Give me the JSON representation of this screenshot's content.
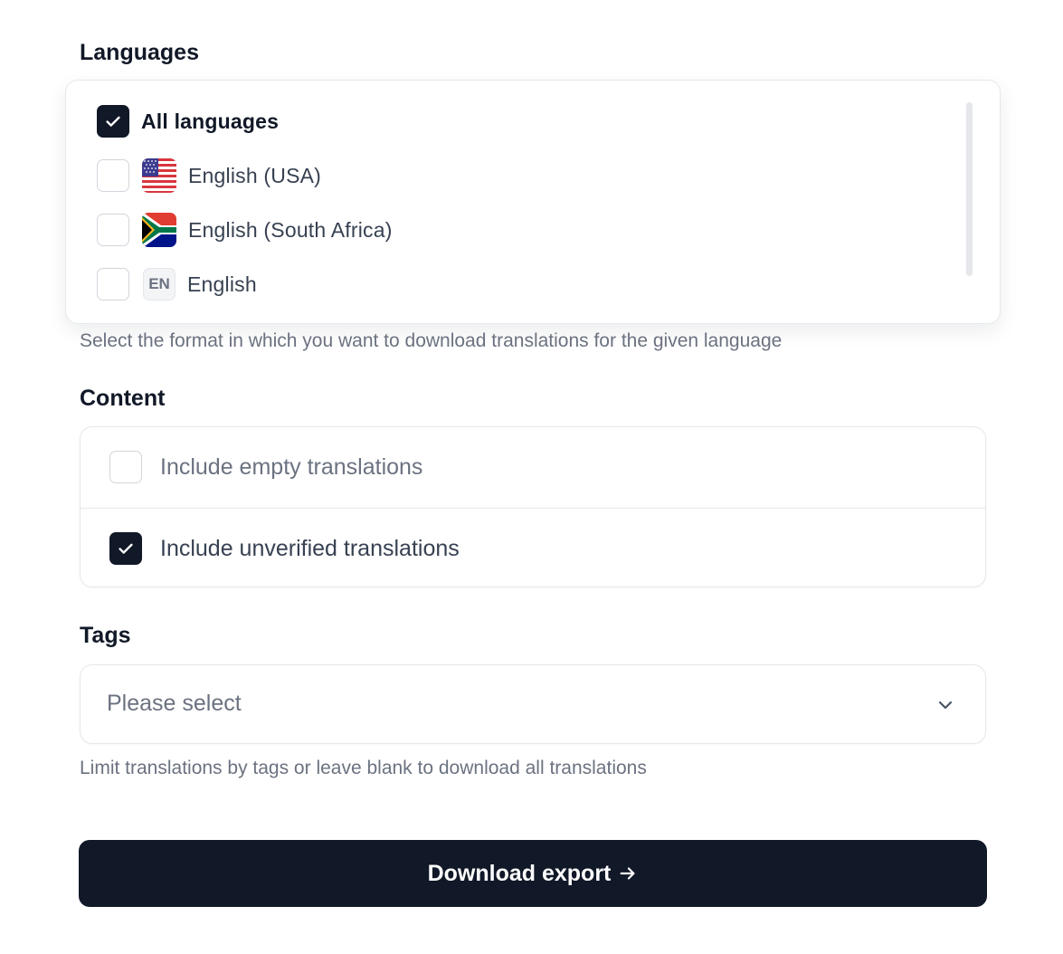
{
  "languages": {
    "label": "Languages",
    "hint": "Select the format in which you want to download translations for the given language",
    "options": [
      {
        "label": "All languages",
        "checked": true
      },
      {
        "label": "English (USA)",
        "checked": false,
        "flag": "us-flag-icon"
      },
      {
        "label": "English (South Africa)",
        "checked": false,
        "flag": "za-flag-icon"
      },
      {
        "label": "English",
        "checked": false,
        "code": "EN"
      }
    ]
  },
  "content": {
    "label": "Content",
    "options": [
      {
        "label": "Include empty translations",
        "checked": false
      },
      {
        "label": "Include unverified translations",
        "checked": true
      }
    ]
  },
  "tags": {
    "label": "Tags",
    "placeholder": "Please select",
    "hint": "Limit translations by tags or leave blank to download all translations"
  },
  "button": {
    "label": "Download export"
  },
  "colors": {
    "primary": "#111827",
    "muted_text": "#6b7280",
    "border": "#e5e7eb"
  }
}
